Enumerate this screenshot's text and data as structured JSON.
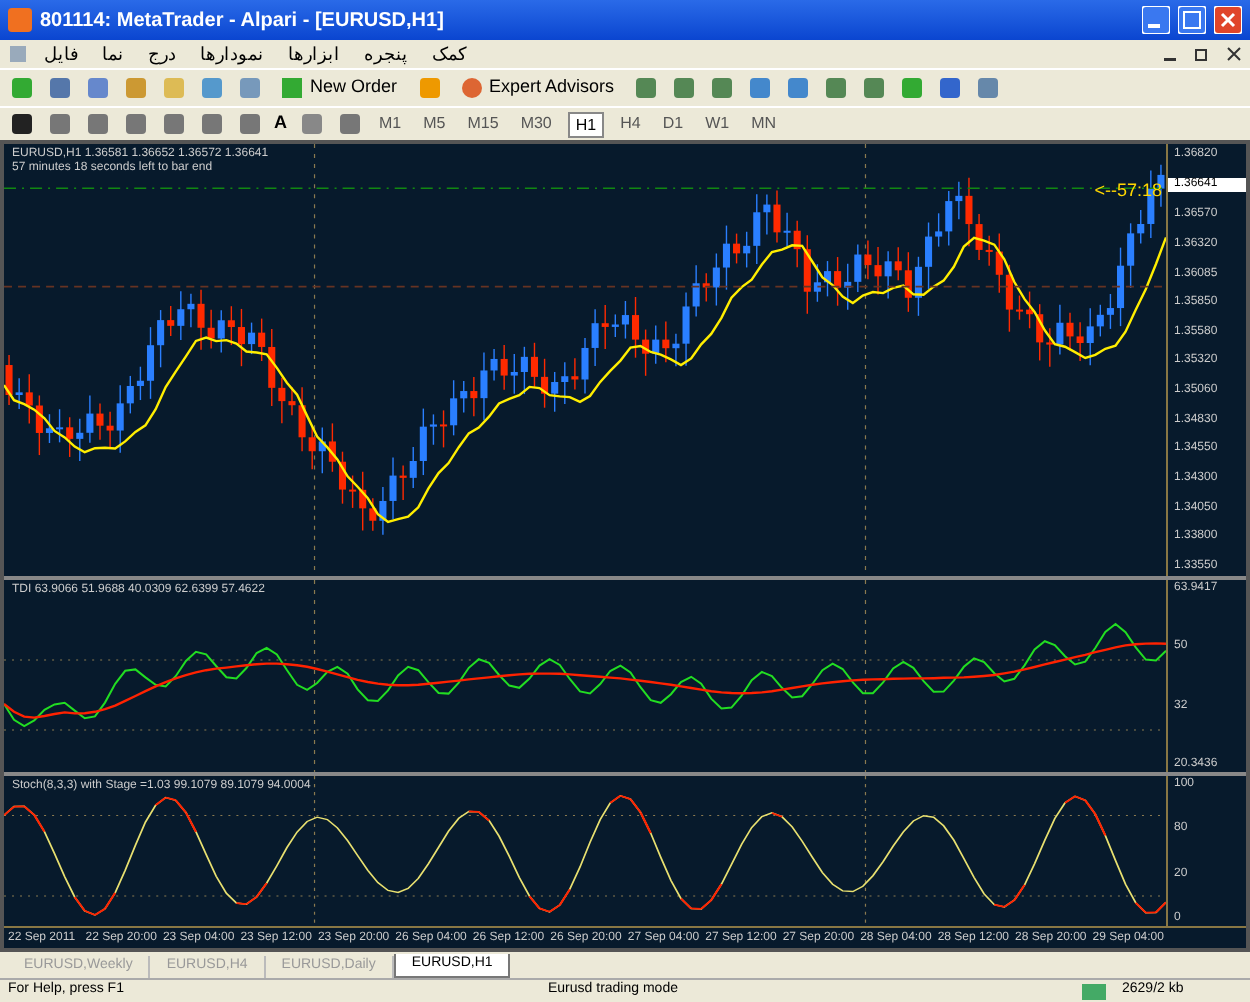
{
  "window": {
    "title": "801114: MetaTrader - Alpari - [EURUSD,H1]"
  },
  "menu": [
    "کمک",
    "پنجره",
    "ابزارها",
    "نمودارها",
    "درج",
    "نما",
    "فایل"
  ],
  "toolbar": {
    "new_order": "New Order",
    "expert_advisors": "Expert Advisors"
  },
  "drawing_tools": {
    "text_tool": "A"
  },
  "timeframes": [
    {
      "label": "M1",
      "selected": false
    },
    {
      "label": "M5",
      "selected": false
    },
    {
      "label": "M15",
      "selected": false
    },
    {
      "label": "M30",
      "selected": false
    },
    {
      "label": "H1",
      "selected": true
    },
    {
      "label": "H4",
      "selected": false
    },
    {
      "label": "D1",
      "selected": false
    },
    {
      "label": "W1",
      "selected": false
    },
    {
      "label": "MN",
      "selected": false
    }
  ],
  "main_panel": {
    "legend": "EURUSD,H1 1.36581 1.36652 1.36572 1.36641",
    "timer": "57 minutes 18 seconds left to bar end",
    "countdown": "<--57:18",
    "current_price": "1.36641",
    "price_labels": [
      "1.36820",
      "1.36570",
      "1.36320",
      "1.36085",
      "1.35850",
      "1.35580",
      "1.35320",
      "1.35060",
      "1.34830",
      "1.34550",
      "1.34300",
      "1.34050",
      "1.33800",
      "1.33550"
    ]
  },
  "tdi_panel": {
    "legend": "TDI 63.9066 51.9688 40.0309 62.6399 57.4622",
    "axis_labels": [
      "63.9417",
      "50",
      "32",
      "20.3436"
    ]
  },
  "stoch_panel": {
    "legend": "Stoch(8,3,3) with Stage =1.03 99.1079 89.1079 94.0004",
    "axis_labels": [
      "100",
      "80",
      "20",
      "0"
    ]
  },
  "time_labels": [
    "22 Sep 2011",
    "22 Sep 20:00",
    "23 Sep 04:00",
    "23 Sep 12:00",
    "23 Sep 20:00",
    "26 Sep 04:00",
    "26 Sep 12:00",
    "26 Sep 20:00",
    "27 Sep 04:00",
    "27 Sep 12:00",
    "27 Sep 20:00",
    "28 Sep 04:00",
    "28 Sep 12:00",
    "28 Sep 20:00",
    "29 Sep 04:00"
  ],
  "chart_tabs": [
    {
      "label": "EURUSD,Weekly",
      "selected": false
    },
    {
      "label": "EURUSD,H4",
      "selected": false
    },
    {
      "label": "EURUSD,Daily",
      "selected": false
    },
    {
      "label": "EURUSD,H1",
      "selected": true
    }
  ],
  "status_bar": {
    "help": "For Help, press F1",
    "profile": "Eurusd trading mode",
    "traffic": "2629/2 kb"
  }
}
